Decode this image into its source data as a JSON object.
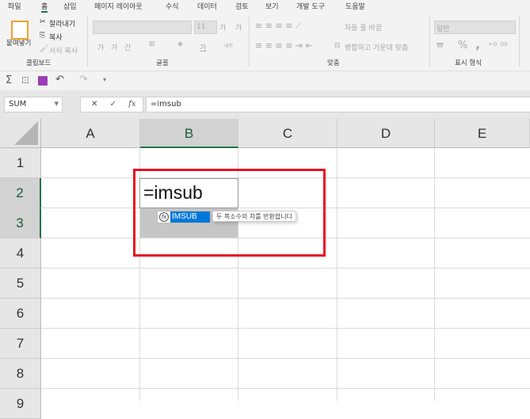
{
  "tabs": [
    "파일",
    "홈",
    "삽입",
    "페이지 레이아웃",
    "수식",
    "데이터",
    "검토",
    "보기",
    "개발 도구",
    "도움말"
  ],
  "ribbon": {
    "clipboard": {
      "paste": "붙여넣기",
      "cut": "잘라내기",
      "copy": "복사",
      "format_painter": "서식 복사",
      "group": "클립보드"
    },
    "font": {
      "size": "11",
      "group": "글꼴",
      "bold": "가",
      "italic": "가",
      "underline": "간",
      "font_color": "가",
      "grow": "가",
      "shrink": "가",
      "phonetic": "내천"
    },
    "alignment": {
      "wrap": "자동 줄 바꿈",
      "merge": "병합하고 가운데 맞춤",
      "group": "맞춤"
    },
    "number": {
      "format": "일반",
      "percent": "%",
      "comma": ",",
      "group": "표시 형식"
    }
  },
  "formula_bar": {
    "name_box": "SUM",
    "formula": "=imsub",
    "fx": "fx"
  },
  "columns": [
    "A",
    "B",
    "C",
    "D",
    "E"
  ],
  "rows": [
    "1",
    "2",
    "3",
    "4",
    "5",
    "6",
    "7",
    "8",
    "9"
  ],
  "cell": {
    "value": "=imsub"
  },
  "autocomplete": {
    "item": "IMSUB",
    "tooltip": "두 복소수의 차를 반환합니다"
  },
  "colors": {
    "highlight": "#e81123",
    "accent": "#217346",
    "selection": "#0078d7"
  }
}
